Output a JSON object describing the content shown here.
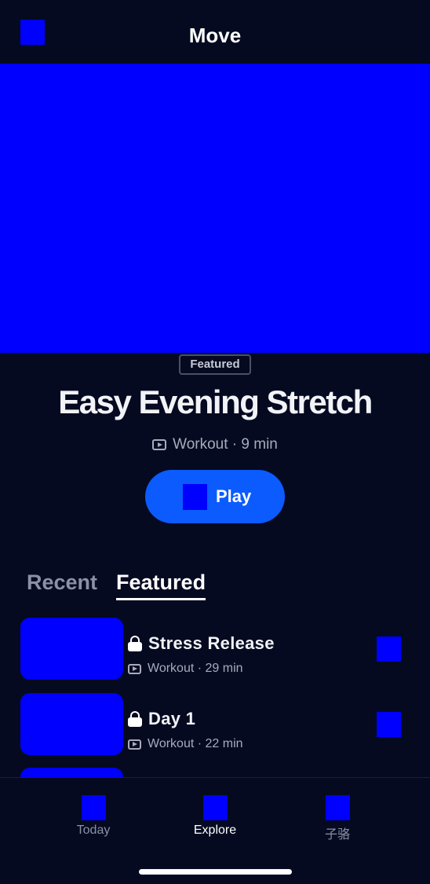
{
  "header": {
    "title": "Move",
    "back_icon": "back-icon"
  },
  "hero": {
    "image": "hero-image"
  },
  "featured": {
    "badge": "Featured",
    "title": "Easy Evening Stretch",
    "meta": "Workout · 9 min",
    "play_label": "Play"
  },
  "tabs": [
    {
      "label": "Recent",
      "active": false
    },
    {
      "label": "Featured",
      "active": true
    }
  ],
  "list": [
    {
      "title": "Stress Release",
      "meta": "Workout · 29 min",
      "locked": true
    },
    {
      "title": "Day 1",
      "meta": "Workout · 22 min",
      "locked": true
    }
  ],
  "bottom_nav": [
    {
      "label": "Today",
      "active": false
    },
    {
      "label": "Explore",
      "active": true
    },
    {
      "label": "子骆",
      "active": false
    }
  ],
  "colors": {
    "background": "#050a21",
    "accent": "#0b5bff",
    "muted_text": "#a7abbc",
    "placeholder": "#0000ff"
  }
}
